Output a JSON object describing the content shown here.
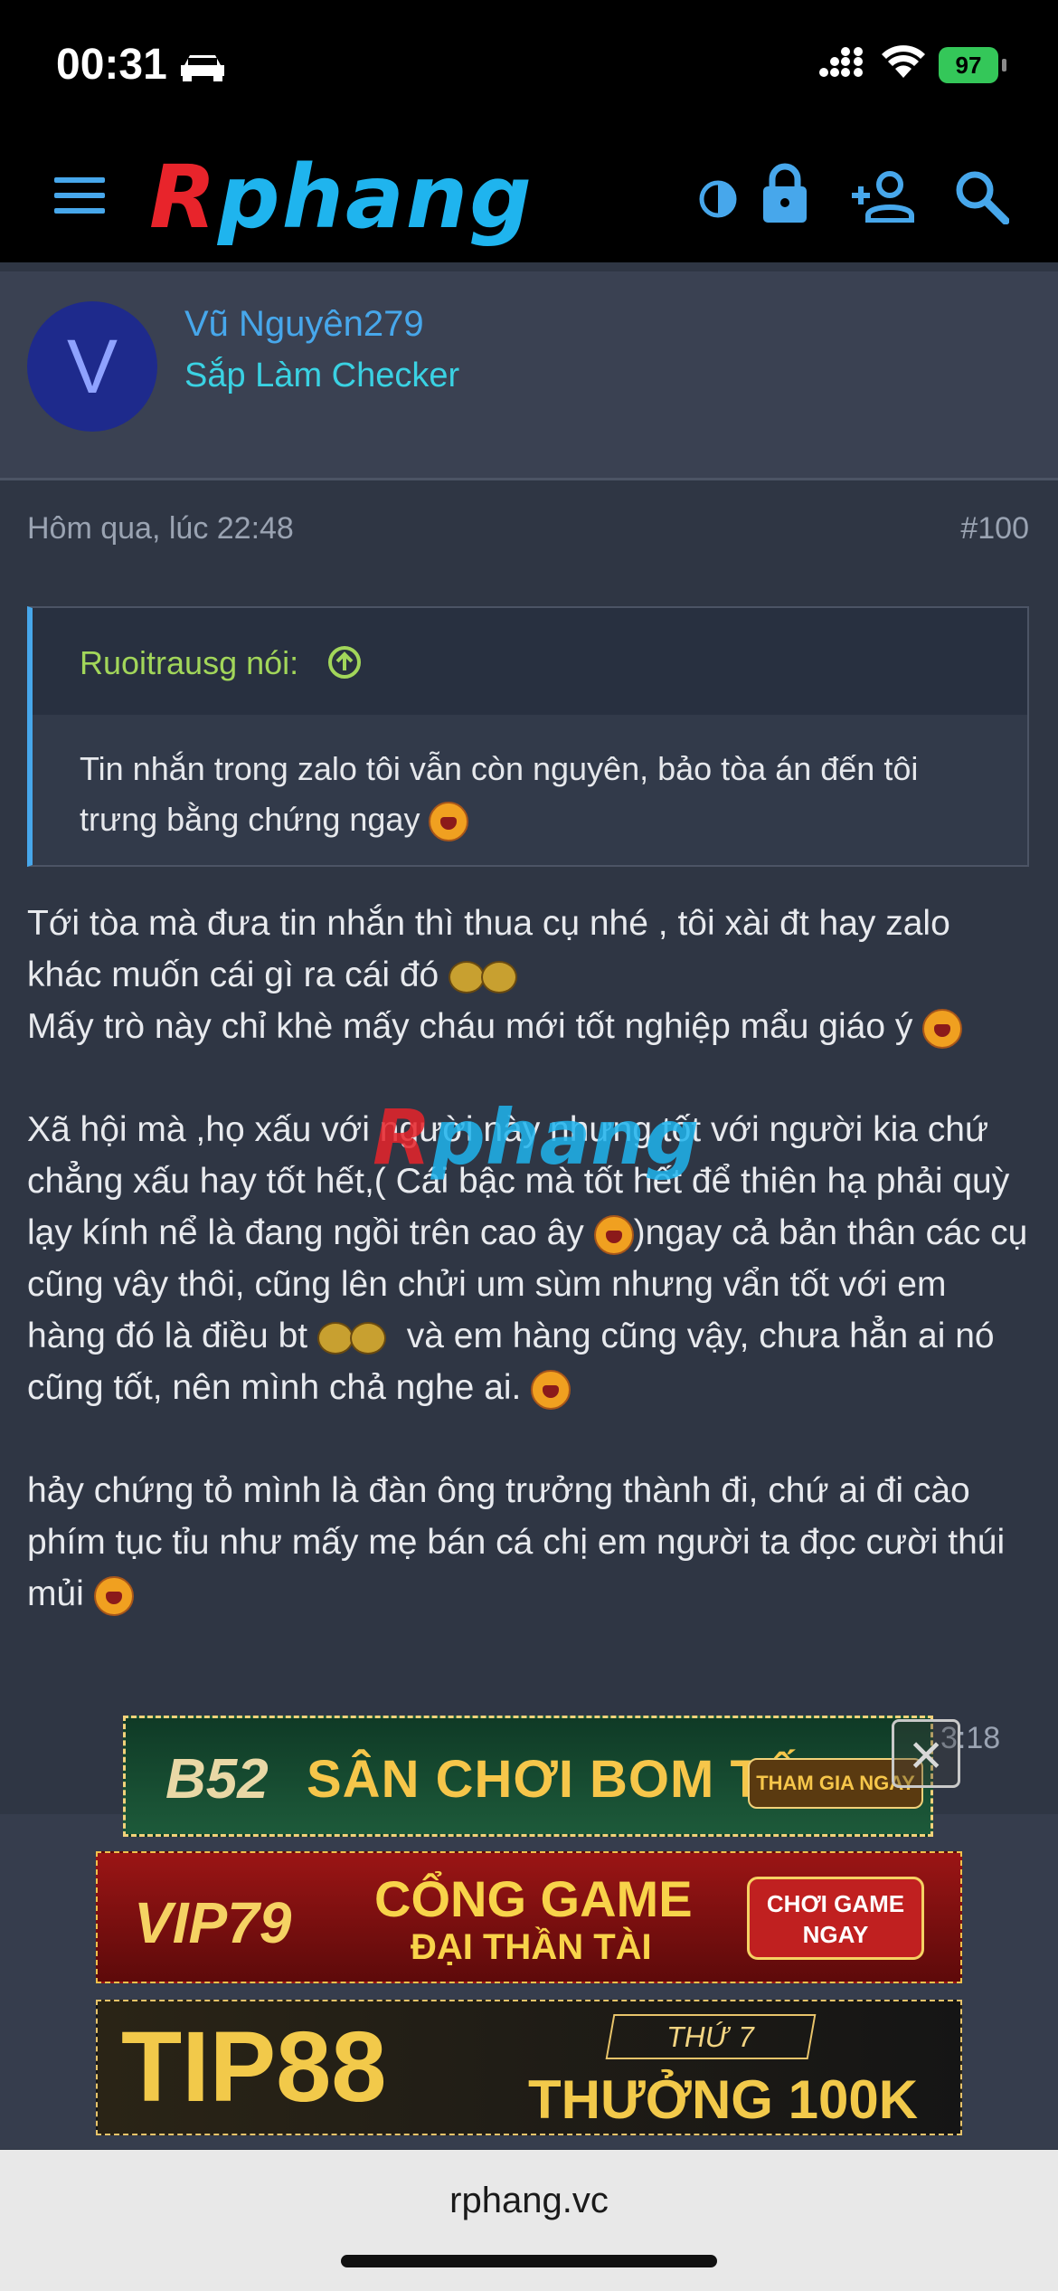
{
  "status_bar": {
    "time": "00:31",
    "battery": "97"
  },
  "header": {
    "logo": {
      "first": "R",
      "rest": "phang"
    }
  },
  "post": {
    "author": {
      "avatar_letter": "V",
      "name": "Vũ Nguyên279",
      "rank": "Sắp Làm Checker"
    },
    "date": "Hôm qua, lúc 22:48",
    "number": "#100",
    "quote": {
      "author": "Ruoitrausg nói:",
      "text": "Tin nhắn trong zalo tôi vẫn còn nguyên, bảo tòa án đến tôi trưng bằng chứng ngay"
    },
    "body": {
      "p1a": "Tới tòa mà đưa tin nhắn thì thua cụ nhé , tôi xài đt hay zalo khác muốn cái gì ra cái đó ",
      "p1b": "Mấy trò này chỉ khè mấy cháu mới tốt nghiệp mẩu giáo ý ",
      "p2a": "Xã hội mà ,họ xấu với người này nhưng tốt với người kia chứ chẳng xấu hay tốt hết,( Cái bậc mà tốt hết để thiên hạ phải quỳ lạy kính nể là đang ngồi trên cao ây ",
      "p2b": ")ngay cả bản thân các cụ cũng vây thôi, cũng lên chửi um sùm nhưng vẩn tốt với em hàng đó là điều bt ",
      "p2c": " và em hàng cũng vậy, chưa hẳn ai nó cũng tốt, nên mình chả nghe ai. ",
      "p3": "hảy chứng tỏ mình là đàn ông trưởng thành đi, chứ ai đi cào phím tục tỉu như mấy mẹ bán cá chị em người ta đọc cười thúi mủi "
    }
  },
  "watermark": {
    "first": "R",
    "rest": "phang"
  },
  "next_post_time": "3:18",
  "ads": {
    "b52": {
      "brand": "B52",
      "slogan": "SÂN CHƠI BOM TẤN",
      "cta": "THAM GIA NGAY"
    },
    "vip79": {
      "brand": "VIP79",
      "line1": "CỔNG GAME",
      "line2": "ĐẠI THẦN TÀI",
      "cta": "CHƠI GAME NGAY"
    },
    "tip88": {
      "brand": "TIP88",
      "line1": "THỨ 7",
      "line2": "THƯỞNG 100K"
    }
  },
  "browser": {
    "url": "rphang.vc"
  },
  "colors": {
    "accent": "#47a7eb",
    "rank": "#3ad2e3",
    "quote_author": "#a2d65a",
    "battery": "#34c759"
  }
}
